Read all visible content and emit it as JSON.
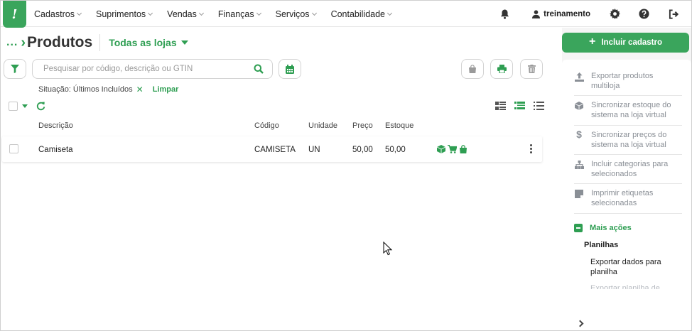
{
  "nav": {
    "logo_text": "!",
    "menu": [
      "Cadastros",
      "Suprimentos",
      "Vendas",
      "Finanças",
      "Serviços",
      "Contabilidade"
    ],
    "user_name": "treinamento",
    "icons": [
      "bell-icon",
      "user-icon",
      "gear-icon",
      "help-icon",
      "logout-icon"
    ]
  },
  "page": {
    "breadcrumb": "...",
    "title": "Produtos",
    "store_selector": "Todas as lojas",
    "search_placeholder": "Pesquisar por código, descrição ou GTIN",
    "filter_label": "Situação: Últimos Incluídos",
    "filter_clear": "Limpar"
  },
  "table": {
    "columns": [
      "Descrição",
      "Código",
      "Unidade",
      "Preço",
      "Estoque"
    ],
    "rows": [
      {
        "descricao": "Camiseta",
        "codigo": "CAMISETA",
        "unidade": "UN",
        "preco": "50,00",
        "estoque": "50,00"
      }
    ]
  },
  "side": {
    "add_button": "Incluir cadastro",
    "actions": [
      "Exportar produtos multiloja",
      "Sincronizar estoque do sistema na loja virtual",
      "Sincronizar preços do sistema na loja virtual",
      "Incluir categorias para selecionados",
      "Imprimir etiquetas selecionadas"
    ],
    "more_actions": "Mais ações",
    "spreadsheets_header": "Planilhas",
    "export_sheet": "Exportar dados para planilha",
    "export_sheet_partial": "Exportar planilha de"
  },
  "colors": {
    "brand_green": "#3aa55c",
    "accent_green": "#2e9e52",
    "muted_text": "#8a8f96"
  }
}
